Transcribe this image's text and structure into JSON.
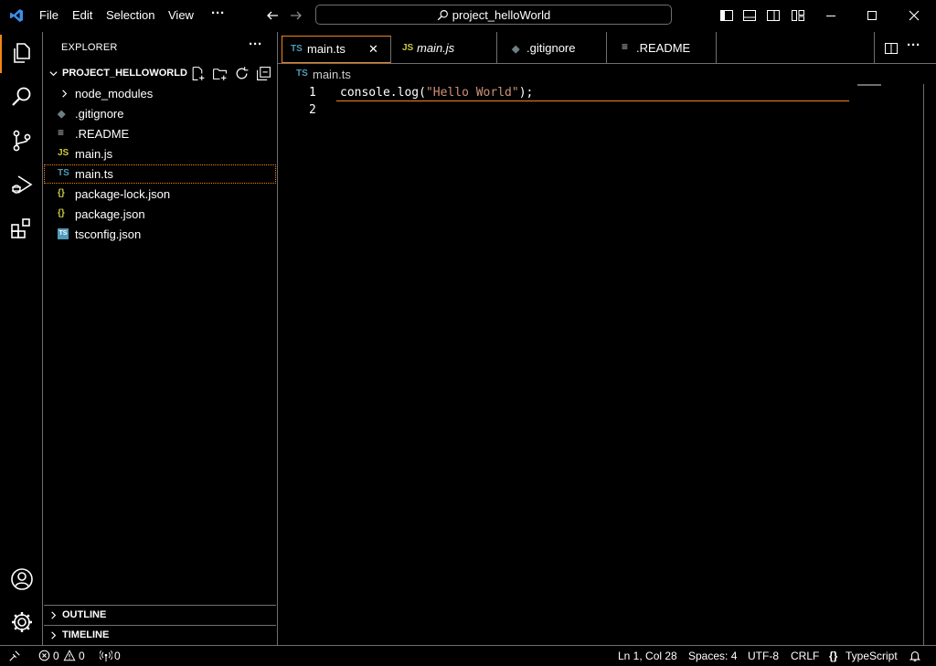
{
  "menu": {
    "file": "File",
    "edit": "Edit",
    "selection": "Selection",
    "view": "View",
    "more": "···"
  },
  "search": {
    "text": "project_helloWorld"
  },
  "explorer": {
    "title": "EXPLORER",
    "more": "···",
    "project": "PROJECT_HELLOWORLD",
    "files": [
      {
        "label": "node_modules",
        "icon": ">"
      },
      {
        "label": ".gitignore",
        "icon": "◆"
      },
      {
        "label": ".README",
        "icon": "≡"
      },
      {
        "label": "main.js",
        "icon": "JS"
      },
      {
        "label": "main.ts",
        "icon": "TS"
      },
      {
        "label": "package-lock.json",
        "icon": "{}"
      },
      {
        "label": "package.json",
        "icon": "{}"
      },
      {
        "label": "tsconfig.json",
        "icon": "TS"
      }
    ],
    "outline": "OUTLINE",
    "timeline": "TIMELINE"
  },
  "tabs": [
    {
      "label": "main.ts",
      "icon": "TS",
      "close": "✕"
    },
    {
      "label": "main.js",
      "icon": "JS"
    },
    {
      "label": ".gitignore",
      "icon": "◆"
    },
    {
      "label": ".README",
      "icon": "≡"
    }
  ],
  "breadcrumb": {
    "icon": "TS",
    "label": "main.ts"
  },
  "editor": {
    "line_numbers": [
      "1",
      "2"
    ],
    "code": {
      "obj": "console",
      "dot": ".",
      "fn": "log",
      "open": "(",
      "str": "\"Hello World\"",
      "close": ");"
    }
  },
  "status": {
    "errors": "0",
    "warnings": "0",
    "ports": "0",
    "position": "Ln 1, Col 28",
    "spaces": "Spaces: 4",
    "encoding": "UTF-8",
    "eol": "CRLF",
    "language": "TypeScript"
  },
  "colors": {
    "accent": "#f38518",
    "border": "#6f6f6f",
    "ts_blue": "#519aba",
    "js_yellow": "#cbcb41",
    "json_yellow": "#cbcb41",
    "string": "#ce9178",
    "vscode_blue": "#3b8eea"
  }
}
